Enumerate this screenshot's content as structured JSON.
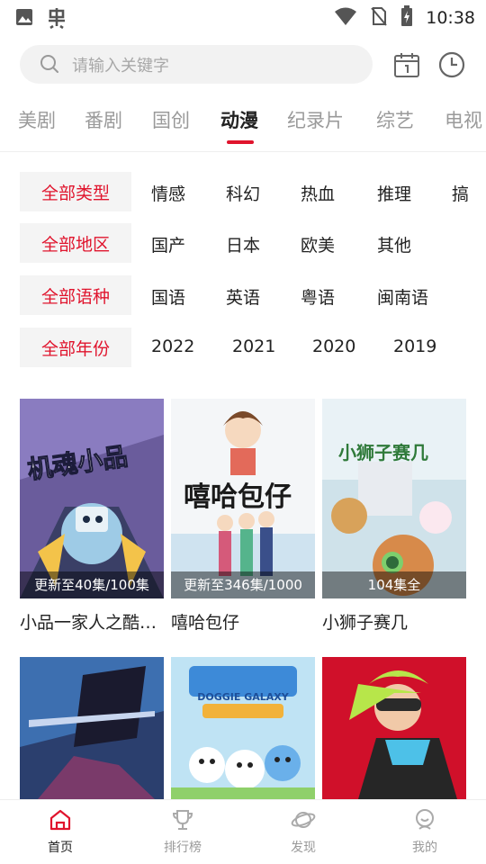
{
  "status_bar": {
    "time": "10:38",
    "left_icons": [
      "image-icon",
      "app-bug-icon"
    ],
    "right_icons": [
      "wifi-icon",
      "no-sim-icon",
      "battery-charging-icon"
    ]
  },
  "search": {
    "placeholder": "请输入关键字",
    "icons": [
      "search-icon",
      "calendar-icon",
      "history-clock-icon"
    ]
  },
  "category_tabs": [
    {
      "label": "美剧",
      "active": false
    },
    {
      "label": "番剧",
      "active": false
    },
    {
      "label": "国创",
      "active": false
    },
    {
      "label": "动漫",
      "active": true
    },
    {
      "label": "纪录片",
      "active": false
    },
    {
      "label": "综艺",
      "active": false
    },
    {
      "label": "电视",
      "active": false
    }
  ],
  "filters": [
    {
      "selected": "全部类型",
      "options": [
        "情感",
        "科幻",
        "热血",
        "推理",
        "搞"
      ]
    },
    {
      "selected": "全部地区",
      "options": [
        "国产",
        "日本",
        "欧美",
        "其他"
      ]
    },
    {
      "selected": "全部语种",
      "options": [
        "国语",
        "英语",
        "粤语",
        "闽南语"
      ]
    },
    {
      "selected": "全部年份",
      "options": [
        "2022",
        "2021",
        "2020",
        "2019"
      ]
    }
  ],
  "items": [
    {
      "title": "小品一家人之酷…",
      "badge": "更新至40集/100集",
      "poster_text": "机魂小品"
    },
    {
      "title": "嘻哈包仔",
      "badge": "更新至346集/1000",
      "poster_text": "嘻哈包仔"
    },
    {
      "title": "小狮子赛几",
      "badge": "104集全",
      "poster_text": "小狮子赛几"
    },
    {
      "title": "",
      "badge": "",
      "poster_text": ""
    },
    {
      "title": "",
      "badge": "",
      "poster_text": "DOGGIE GALAXY"
    },
    {
      "title": "",
      "badge": "",
      "poster_text": ""
    }
  ],
  "bottom_nav": [
    {
      "label": "首页",
      "icon": "home-icon",
      "active": true
    },
    {
      "label": "排行榜",
      "icon": "trophy-icon",
      "active": false
    },
    {
      "label": "发现",
      "icon": "planet-icon",
      "active": false
    },
    {
      "label": "我的",
      "icon": "user-icon",
      "active": false
    }
  ],
  "colors": {
    "accent": "#e0142d",
    "chip_bg": "#f4f4f4",
    "muted_text": "#9a9a9a"
  }
}
